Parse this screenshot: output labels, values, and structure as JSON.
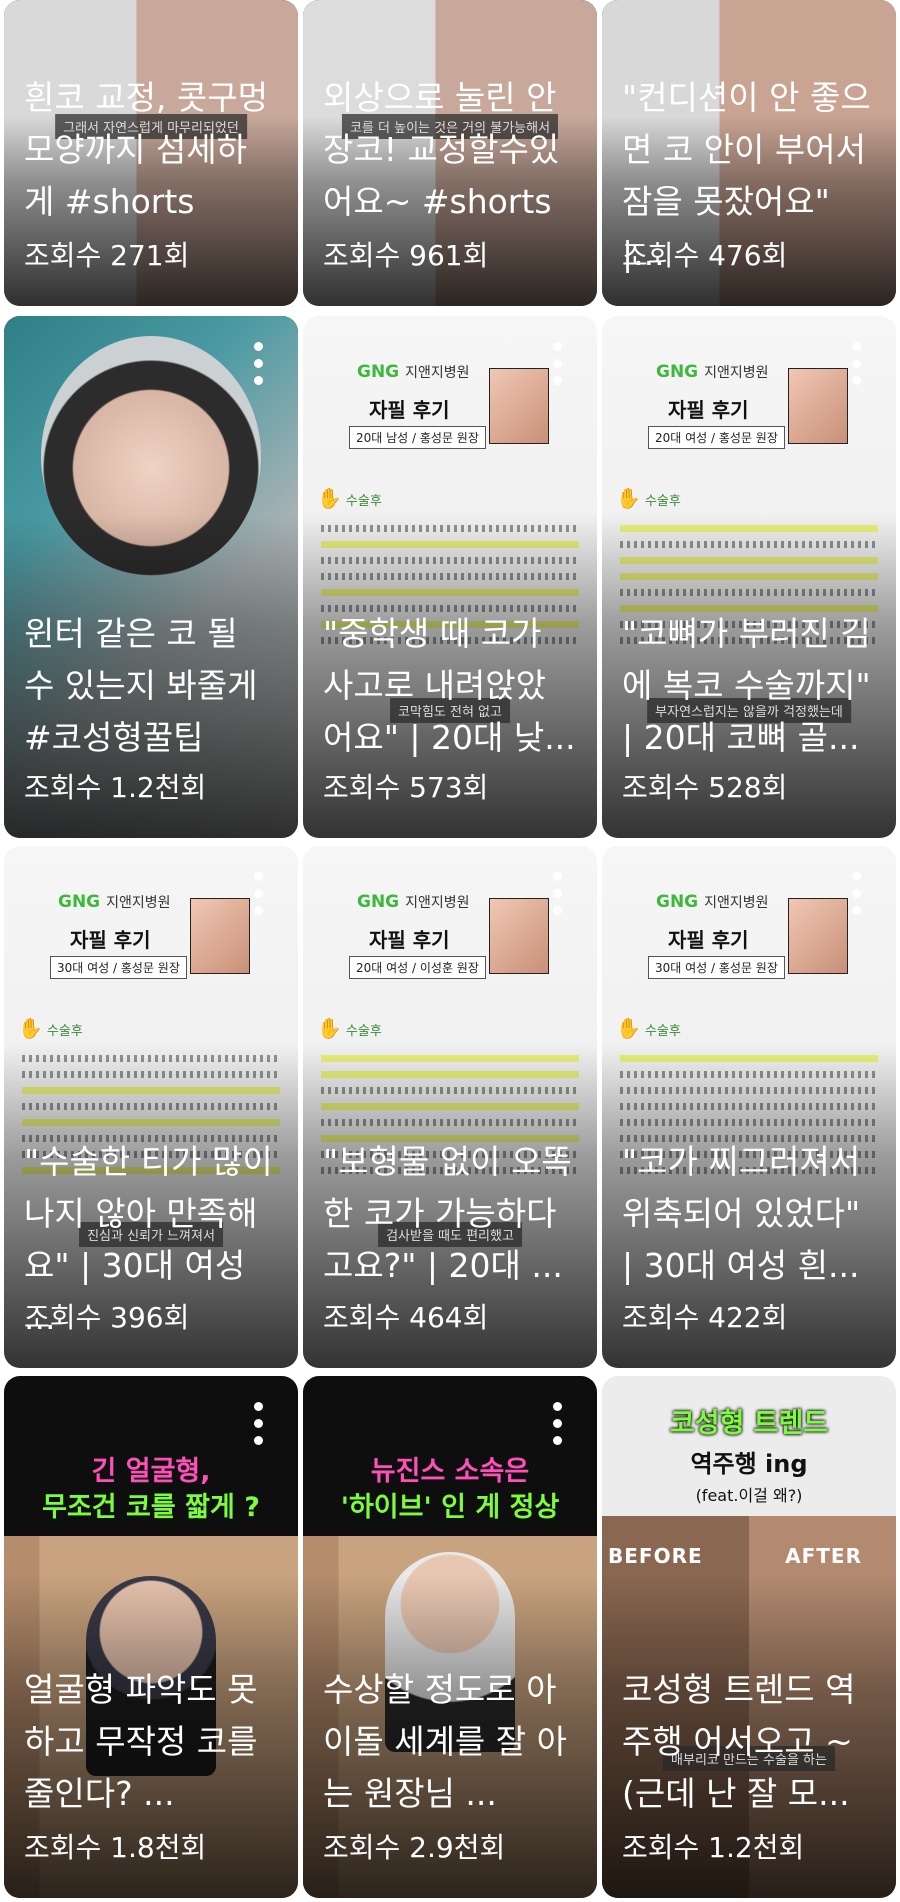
{
  "cards": [
    {
      "title": "흰코 교정, 콧구멍\n모양까지 섬세하\n게 #shorts",
      "views": "조회수 271회",
      "caption": "그래서 자연스럽게 마무리되었던"
    },
    {
      "title": "외상으로 눌린 안\n장코! 교정할수있\n어요~ #shorts",
      "views": "조회수 961회",
      "caption": "코를 더 높이는 것은 거의 불가능해서"
    },
    {
      "title": "\"컨디션이 안 좋으\n면 코 안이 부어서\n잠을 못잤어요\" |...",
      "views": "조회수 476회",
      "caption": ""
    },
    {
      "title": "윈터 같은 코 될\n수 있는지 봐줄게\n#코성형꿀팁",
      "views": "조회수 1.2천회",
      "caption": ""
    },
    {
      "title": "\"중학생 때 코가\n사고로 내려앉았\n어요\" | 20대 낮...",
      "views": "조회수 573회",
      "caption": "코막힘도 전혀 없고",
      "doc": {
        "logo": "GNG",
        "hospital": "지앤지병원",
        "heading": "자필 후기",
        "tag": "20대 남성 / 홍성문 원장",
        "hand": "수술후"
      }
    },
    {
      "title": "\"코뼈가 부러진 김\n에 복코 수술까지\"\n| 20대 코뼈 골...",
      "views": "조회수 528회",
      "caption": "부자연스럽지는 않을까 걱정했는데",
      "doc": {
        "logo": "GNG",
        "hospital": "지앤지병원",
        "heading": "자필 후기",
        "tag": "20대 여성 / 홍성문 원장",
        "hand": "수술후"
      }
    },
    {
      "title": "\"수술한 티가 많이\n나지 않아 만족해\n요\" | 30대 여성 ...",
      "views": "조회수 396회",
      "caption": "진심과 신뢰가 느껴져서",
      "doc": {
        "logo": "GNG",
        "hospital": "지앤지병원",
        "heading": "자필 후기",
        "tag": "30대 여성 / 홍성문 원장",
        "hand": "수술후"
      }
    },
    {
      "title": "\"보형물 없이 오똑\n한 코가 가능하다\n고요?\" | 20대 ...",
      "views": "조회수 464회",
      "caption": "검사받을 때도 편리했고",
      "doc": {
        "logo": "GNG",
        "hospital": "지앤지병원",
        "heading": "자필 후기",
        "tag": "20대 여성 / 이성훈 원장",
        "hand": "수술후"
      }
    },
    {
      "title": "\"코가 찌그러져서\n위축되어 있었다\"\n| 30대 여성 흰...",
      "views": "조회수 422회",
      "caption": "",
      "doc": {
        "logo": "GNG",
        "hospital": "지앤지병원",
        "heading": "자필 후기",
        "tag": "30대 여성 / 홍성문 원장",
        "hand": "수술후"
      }
    },
    {
      "title": "얼굴형 파악도 못\n하고 무작정 코를\n줄인다? ...",
      "views": "조회수 1.8천회",
      "caption": "",
      "header1": "긴 얼굴형,",
      "header2": "무조건 코를 짧게 ?"
    },
    {
      "title": "수상할 정도로 아\n이돌 세계를 잘 아\n는 원장님 ...",
      "views": "조회수 2.9천회",
      "caption": "",
      "header1": "뉴진스 소속은",
      "header2": "'하이브' 인 게 정상"
    },
    {
      "title": "코성형 트렌드 역\n주행 어서오고 ~\n(근데 난 잘 모...",
      "views": "조회수 1.2천회",
      "caption": "매부리코 만드는 수술을 하는",
      "header1": "코성형 트렌드",
      "header2": "역주행 ing",
      "header3": "(feat.이걸 왜?)",
      "before": "BEFORE",
      "after": "AFTER"
    }
  ],
  "colors": {
    "pink": "#ff4fb8",
    "green": "#7CFC3A",
    "highlight": "#e8f07a"
  }
}
